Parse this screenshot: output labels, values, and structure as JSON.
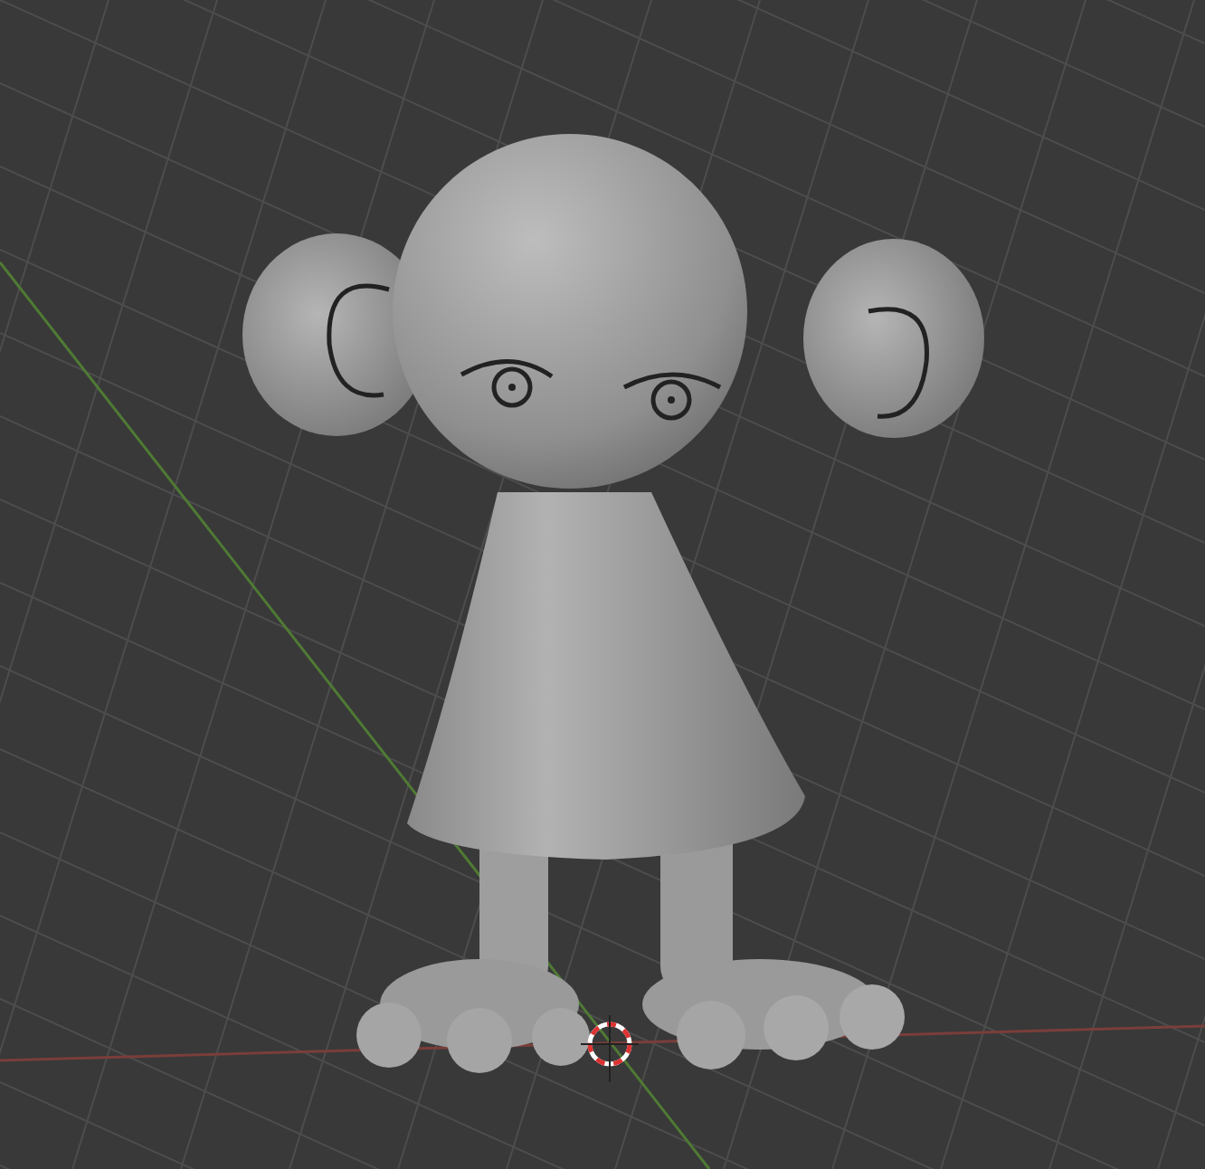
{
  "viewport": {
    "show_grid": true,
    "show_axes": true,
    "show_cursor": true
  }
}
